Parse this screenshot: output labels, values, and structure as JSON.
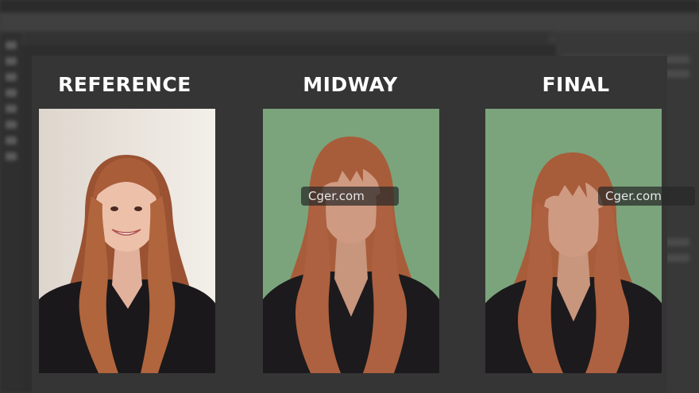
{
  "columns": [
    {
      "title": "REFERENCE"
    },
    {
      "title": "MIDWAY"
    },
    {
      "title": "FINAL"
    }
  ],
  "watermarks": [
    "Cger.com",
    "Cger.com"
  ],
  "colors": {
    "background_green": "#7ba47c",
    "hair": "#a85d3a",
    "skin": "#cf9a82",
    "shirt": "#1c1a1c",
    "panel": "#353535"
  }
}
